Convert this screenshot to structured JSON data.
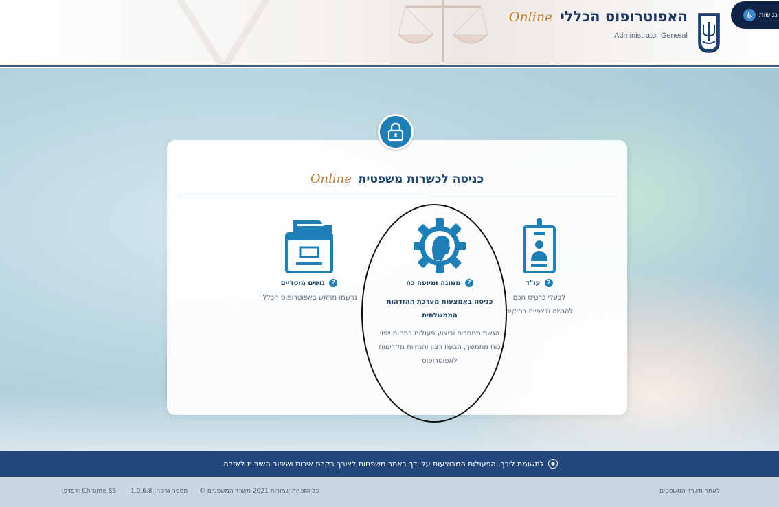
{
  "header": {
    "brand_title": "האפוטרופוס הכללי",
    "brand_online": "Online",
    "brand_subtitle": "Administrator General",
    "accessibility_label": "נגישות"
  },
  "card": {
    "title": "כניסה לכשרות משפטית",
    "title_online": "Online",
    "options": {
      "right": {
        "title": "עו\"ד",
        "description": "לבעלי כרטיס חכם להגשה ולצפייה בתיקים"
      },
      "center": {
        "title": "ממונה ומיופה כח",
        "link": "כניסה באמצעות מערכת ההזדהות הממשלתית",
        "description": "הגשת מסמכים וביצוע פעולות בתחום ייפוי כוח מתמשך, הבעת רצון והנחיות מקדימות לאפוטרופוס"
      },
      "left": {
        "title": "גופים מוסדיים",
        "description": "נרשמו מראש באפוטרופוס הכללי"
      }
    }
  },
  "notice": {
    "text": "לתשומת ליבך, הפעולות המבוצעות על ידך באתר משפחות לצורך בקרת איכות ושיפור השירות לאזרח."
  },
  "footer": {
    "copyright": "כל הזכויות שמורות 2021 משרד המשפטים ©",
    "version": "מספר גרסה: 1.0.6.8",
    "browser": "דפדפן: Chrome 88",
    "ministry_link": "לאתר משרד המשפטים"
  },
  "colors": {
    "brand_navy": "#1c3760",
    "accent_blue": "#1e7fb6",
    "notice_bar": "#23477b",
    "footer_bg": "#c9d7e3",
    "online_gold": "#c27d2a"
  },
  "icons": {
    "accessibility": "accessibility-icon",
    "emblem": "state-emblem-icon",
    "lock": "lock-icon",
    "id_badge": "id-badge-icon",
    "gear_person": "gear-person-icon",
    "cabinet": "file-cabinet-icon",
    "help": "question-icon",
    "notice": "info-circle-icon"
  }
}
